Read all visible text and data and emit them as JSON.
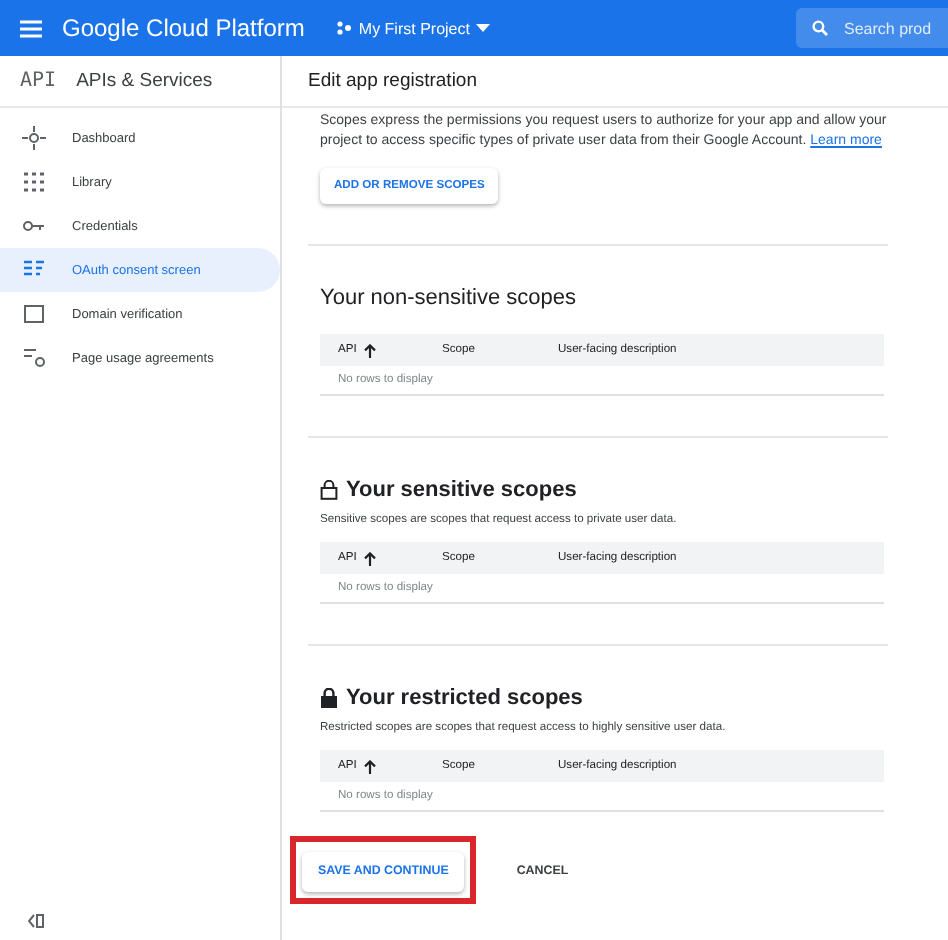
{
  "topbar": {
    "product": "Google Cloud Platform",
    "project": "My First Project",
    "search_placeholder": "Search prod"
  },
  "sidebar": {
    "logo": "API",
    "title": "APIs & Services",
    "items": [
      {
        "label": "Dashboard",
        "selected": false
      },
      {
        "label": "Library",
        "selected": false
      },
      {
        "label": "Credentials",
        "selected": false
      },
      {
        "label": "OAuth consent screen",
        "selected": true
      },
      {
        "label": "Domain verification",
        "selected": false
      },
      {
        "label": "Page usage agreements",
        "selected": false
      }
    ]
  },
  "page_title": "Edit app registration",
  "intro": {
    "text": "Scopes express the permissions you request users to authorize for your app and allow your project to access specific types of private user data from their Google Account.",
    "link": "Learn more"
  },
  "add_button": "ADD OR REMOVE SCOPES",
  "sections": [
    {
      "title": "Your non-sensitive scopes",
      "kind": "plain",
      "columns": [
        "API",
        "Scope",
        "User-facing description"
      ],
      "empty": "No rows to display"
    },
    {
      "title": "Your sensitive scopes",
      "kind": "sensitive",
      "description": "Sensitive scopes are scopes that request access to private user data.",
      "columns": [
        "API",
        "Scope",
        "User-facing description"
      ],
      "empty": "No rows to display"
    },
    {
      "title": "Your restricted scopes",
      "kind": "restricted",
      "description": "Restricted scopes are scopes that request access to highly sensitive user data.",
      "columns": [
        "API",
        "Scope",
        "User-facing description"
      ],
      "empty": "No rows to display"
    }
  ],
  "actions": [
    {
      "label": "SAVE AND CONTINUE",
      "kind": "primary",
      "highlighted": true
    },
    {
      "label": "CANCEL",
      "kind": "text",
      "highlighted": false
    }
  ]
}
